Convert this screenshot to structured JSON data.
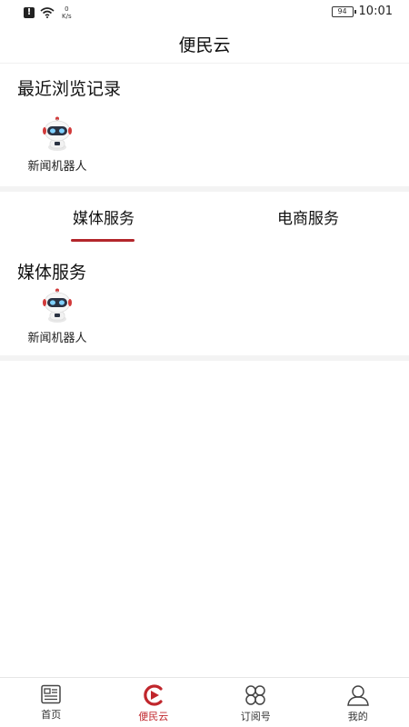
{
  "status_bar": {
    "speed_value": "0",
    "speed_unit": "K/s",
    "battery": "94",
    "time": "10:01"
  },
  "header": {
    "title": "便民云"
  },
  "recent": {
    "title": "最近浏览记录",
    "items": [
      {
        "label": "新闻机器人",
        "icon": "robot-icon"
      }
    ]
  },
  "tabs": [
    {
      "label": "媒体服务",
      "active": true
    },
    {
      "label": "电商服务",
      "active": false
    }
  ],
  "media_service": {
    "title": "媒体服务",
    "items": [
      {
        "label": "新闻机器人",
        "icon": "robot-icon"
      }
    ]
  },
  "bottom_nav": {
    "items": [
      {
        "label": "首页",
        "icon": "news-icon",
        "active": false
      },
      {
        "label": "便民云",
        "icon": "play-logo-icon",
        "active": true
      },
      {
        "label": "订阅号",
        "icon": "grid-icon",
        "active": false
      },
      {
        "label": "我的",
        "icon": "user-icon",
        "active": false
      }
    ]
  },
  "colors": {
    "accent": "#c0262c",
    "divider": "#f3f3f3"
  }
}
